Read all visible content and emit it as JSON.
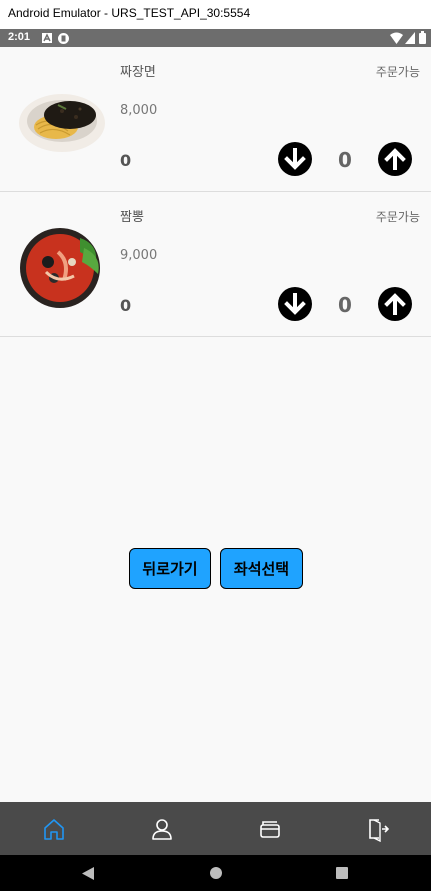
{
  "window": {
    "title": "Android Emulator - URS_TEST_API_30:5554"
  },
  "status_bar": {
    "time": "2:01"
  },
  "menu": {
    "items": [
      {
        "name": "짜장면",
        "price": "8,000",
        "status": "주문가능",
        "total": "0",
        "quantity": "0"
      },
      {
        "name": "짬뽕",
        "price": "9,000",
        "status": "주문가능",
        "total": "0",
        "quantity": "0"
      }
    ]
  },
  "actions": {
    "back_label": "뒤로가기",
    "select_seat_label": "좌석선택"
  },
  "bottom_nav": {
    "active_color": "#2196f3",
    "inactive_color": "#ffffff",
    "items": [
      {
        "icon": "home-icon",
        "active": true
      },
      {
        "icon": "person-icon",
        "active": false
      },
      {
        "icon": "card-icon",
        "active": false
      },
      {
        "icon": "logout-icon",
        "active": false
      }
    ]
  },
  "colors": {
    "button_fill": "#1fa3ff",
    "status_bar": "#6d6d6d",
    "nav_bar": "#4a4a4a"
  }
}
